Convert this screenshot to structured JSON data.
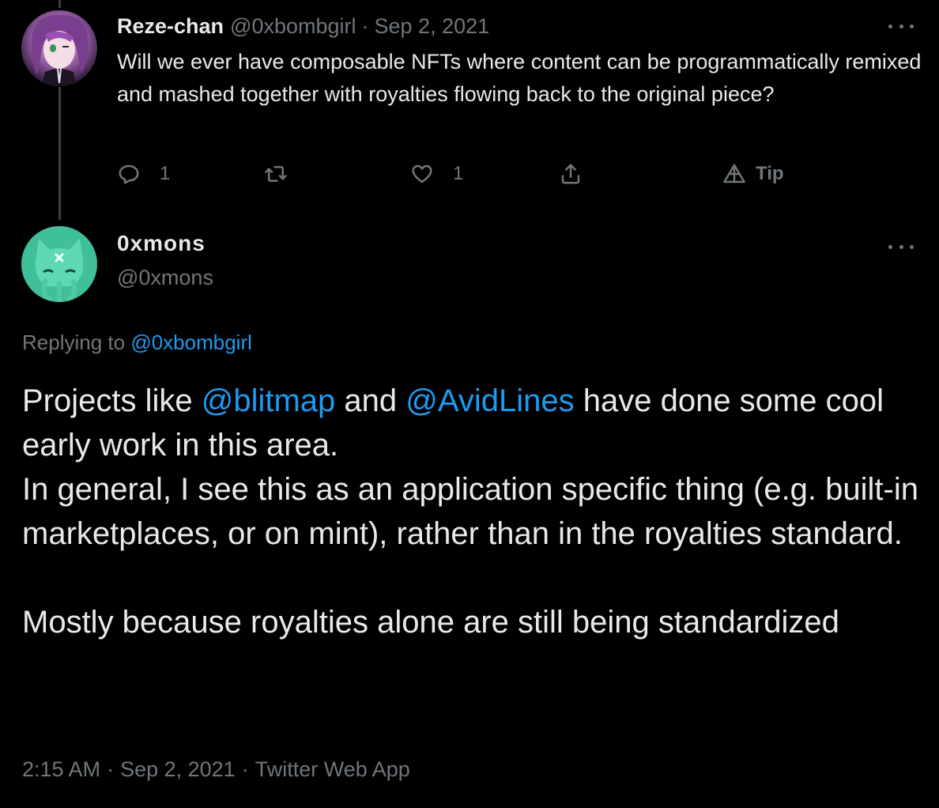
{
  "colors": {
    "background": "#000000",
    "text": "#e7e9ea",
    "secondary": "#71767b",
    "link": "#1d9bf0",
    "thread_line": "#3e4144"
  },
  "parent_tweet": {
    "display_name": "Reze-chan",
    "handle": "@0xbombgirl",
    "separator": "·",
    "date": "Sep 2, 2021",
    "text": "Will we ever have composable NFTs where content can be programmatically remixed and mashed together with royalties flowing back to the original piece?",
    "more_icon": "more-icon",
    "actions": {
      "reply_icon": "reply-icon",
      "reply_count": "1",
      "retweet_icon": "retweet-icon",
      "like_icon": "heart-icon",
      "like_count": "1",
      "share_icon": "share-icon",
      "tip_icon": "tip-icon",
      "tip_label": "Tip"
    }
  },
  "reply_tweet": {
    "display_name": "0xmons",
    "handle": "@0xmons",
    "more_icon": "more-icon",
    "replying_prefix": "Replying to",
    "replying_handle": "@0xbombgirl",
    "body": {
      "p1_before": "Projects like ",
      "mention1": "@blitmap",
      "p1_mid": " and ",
      "mention2": "@AvidLines",
      "p1_after": " have done some cool early work in this area.",
      "p2": "In general, I see this as an application specific thing (e.g. built-in marketplaces, or on mint), rather than in the royalties standard.",
      "p3": "Mostly because royalties alone are still being standardized"
    },
    "meta": {
      "time": "2:15 AM",
      "separator": "·",
      "date": "Sep 2, 2021",
      "source": "Twitter Web App"
    }
  }
}
